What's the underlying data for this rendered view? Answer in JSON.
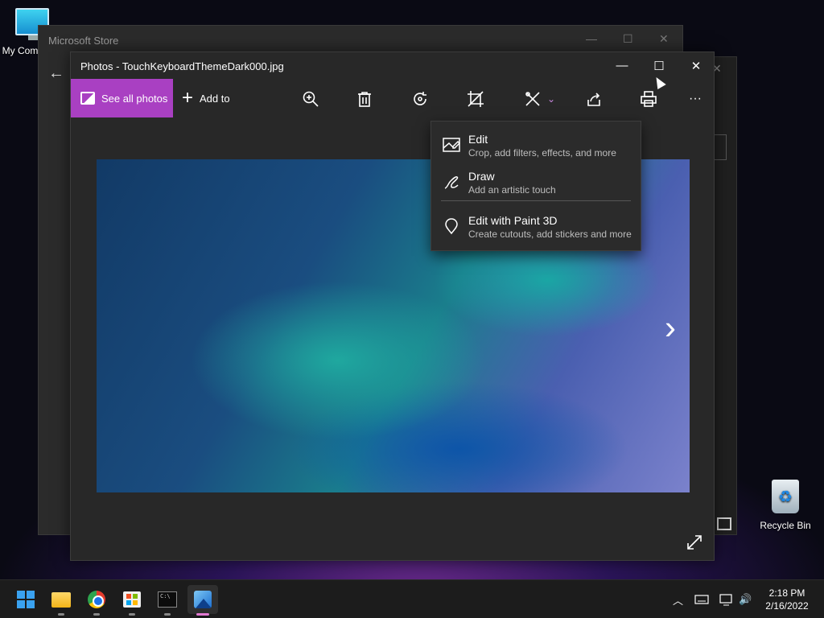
{
  "desktop": {
    "icons": [
      {
        "label": "My Com"
      },
      {
        "label": "Recycle Bin"
      }
    ]
  },
  "store_window": {
    "title": "Microsoft Store",
    "back_glyph": "←",
    "minimize_glyph": "—",
    "maximize_glyph": "☐",
    "close_glyph": "✕",
    "right_close_glyph": "✕"
  },
  "photos_window": {
    "title": "Photos - TouchKeyboardThemeDark000.jpg",
    "minimize_glyph": "—",
    "maximize_glyph": "☐",
    "close_glyph": "✕",
    "toolbar": {
      "see_all_label": "See all photos",
      "add_to_label": "Add to",
      "add_glyph": "+",
      "more_glyph": "···",
      "icons": [
        "zoom-in-icon",
        "delete-icon",
        "rotate-icon",
        "crop-icon",
        "edit-draw-icon",
        "share-icon",
        "print-icon",
        "more-icon"
      ]
    },
    "next_glyph": "›",
    "accent_color": "#a940c2"
  },
  "edit_menu": {
    "items": [
      {
        "title": "Edit",
        "subtitle": "Crop, add filters, effects, and more",
        "icon": "edit-image-icon"
      },
      {
        "title": "Draw",
        "subtitle": "Add an artistic touch",
        "icon": "draw-icon"
      },
      {
        "title": "Edit with Paint 3D",
        "subtitle": "Create cutouts, add stickers and more",
        "icon": "paint3d-icon"
      }
    ]
  },
  "taskbar": {
    "apps": [
      "start-button",
      "file-explorer",
      "chrome",
      "microsoft-store",
      "terminal",
      "photos"
    ],
    "terminal_text": "C:\\",
    "tray": {
      "chevron": "︿",
      "volume_glyph": "🔊"
    },
    "clock": {
      "time": "2:18 PM",
      "date": "2/16/2022"
    }
  }
}
